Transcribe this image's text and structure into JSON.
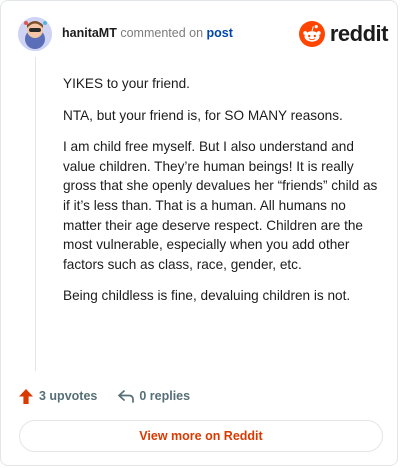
{
  "comment": {
    "username": "hanitaMT",
    "commented_on_text": "commented on",
    "post_link": "post",
    "paragraphs": [
      "YIKES to your friend.",
      "NTA, but your friend is, for SO MANY reasons.",
      "I am child free myself. But I also understand and value children. They’re human beings! It is really gross that she openly devalues her “friends” child as if it’s less than. That is a human. All humans no matter their age deserve respect. Children are the most vulnerable, especially when you add other factors such as class, race, gender, etc.",
      "Being childless is fine, devaluing children is not."
    ]
  },
  "brand": {
    "name": "reddit",
    "accent": "#ff4500"
  },
  "actions": {
    "upvotes": "3 upvotes",
    "replies": "0 replies"
  },
  "footer": {
    "view_more": "View more on Reddit"
  },
  "colors": {
    "upvote": "#d93a00",
    "link": "#0045ac",
    "muted": "#576f76",
    "border": "#e3e6e8"
  }
}
